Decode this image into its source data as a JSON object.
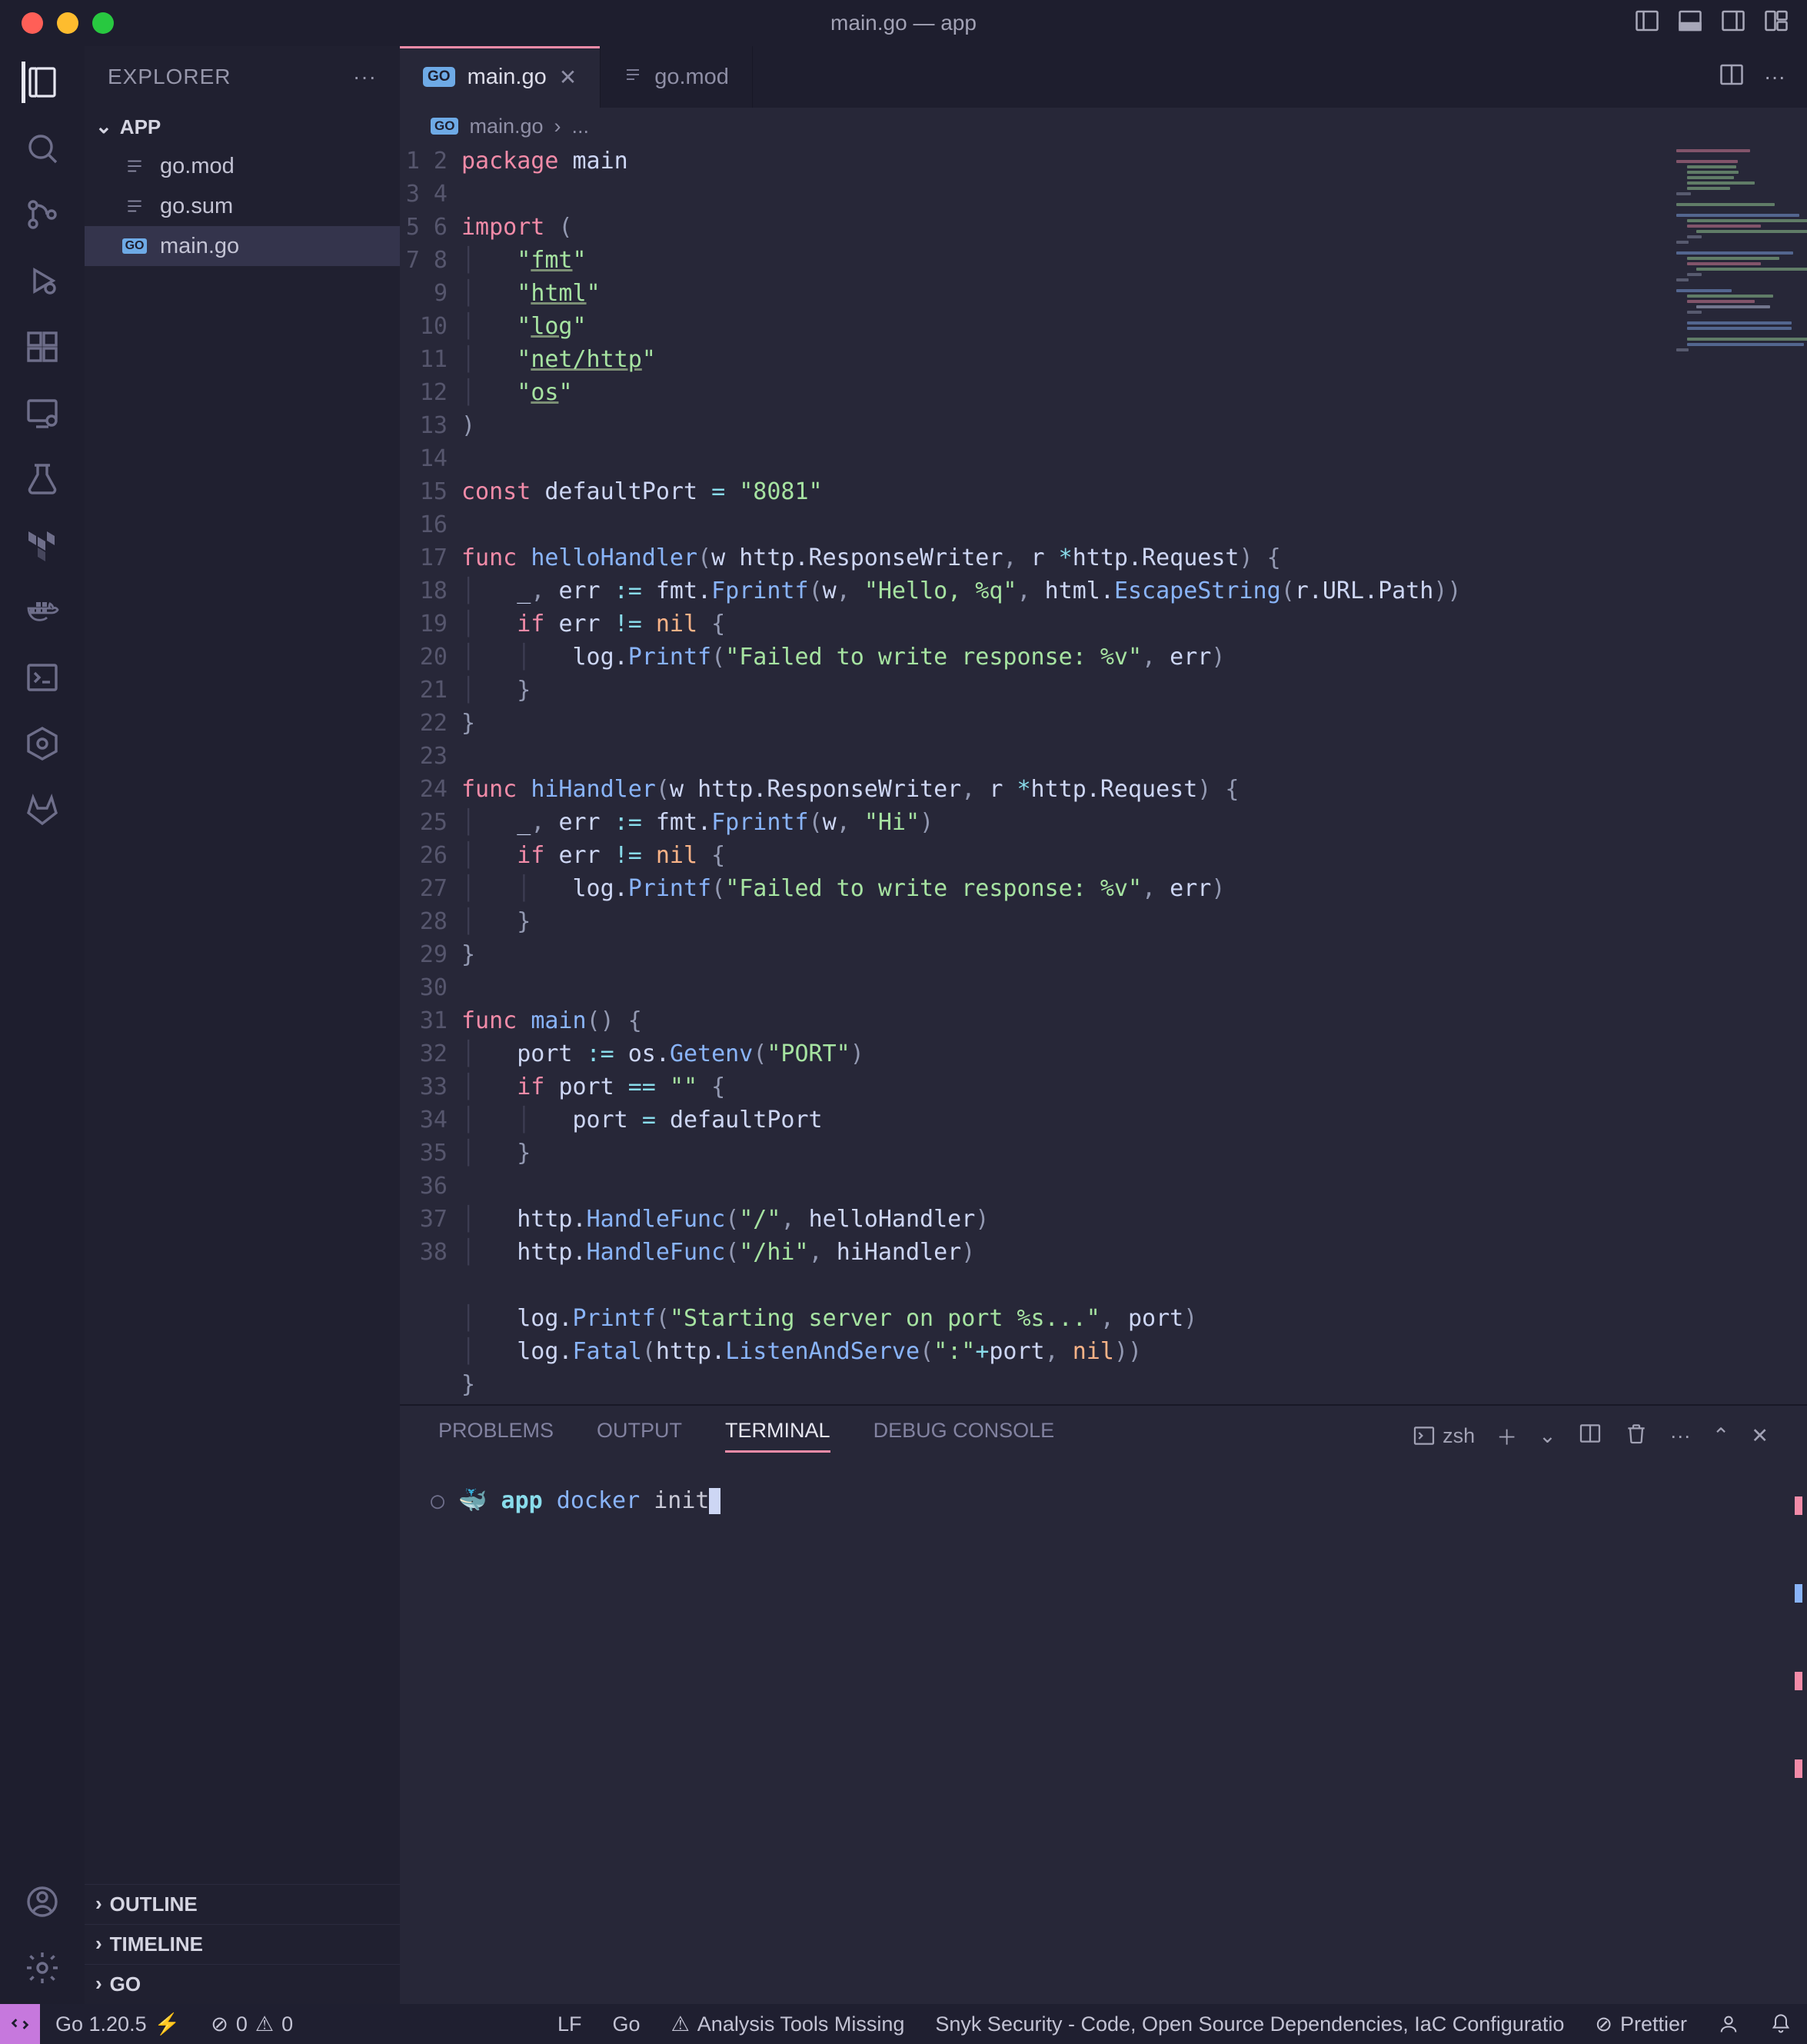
{
  "window": {
    "title": "main.go — app"
  },
  "explorer": {
    "title": "EXPLORER",
    "root": "APP",
    "files": [
      {
        "name": "go.mod",
        "icon": "lines"
      },
      {
        "name": "go.sum",
        "icon": "lines"
      },
      {
        "name": "main.go",
        "icon": "go",
        "selected": true
      }
    ],
    "collapsed": [
      "OUTLINE",
      "TIMELINE",
      "GO"
    ]
  },
  "tabs": [
    {
      "label": "main.go",
      "icon": "go",
      "active": true,
      "closable": true
    },
    {
      "label": "go.mod",
      "icon": "lines",
      "active": false,
      "closable": false
    }
  ],
  "breadcrumb": {
    "file": "main.go",
    "more": "..."
  },
  "code": {
    "lines": [
      [
        [
          "kw",
          "package"
        ],
        [
          "sp",
          " "
        ],
        [
          "pkg",
          "main"
        ]
      ],
      [],
      [
        [
          "kw",
          "import"
        ],
        [
          "sp",
          " "
        ],
        [
          "paren",
          "("
        ]
      ],
      [
        [
          "sp",
          "    "
        ],
        [
          "str",
          "\""
        ],
        [
          "strund",
          "fmt"
        ],
        [
          "str",
          "\""
        ]
      ],
      [
        [
          "sp",
          "    "
        ],
        [
          "str",
          "\""
        ],
        [
          "strund",
          "html"
        ],
        [
          "str",
          "\""
        ]
      ],
      [
        [
          "sp",
          "    "
        ],
        [
          "str",
          "\""
        ],
        [
          "strund",
          "log"
        ],
        [
          "str",
          "\""
        ]
      ],
      [
        [
          "sp",
          "    "
        ],
        [
          "str",
          "\""
        ],
        [
          "strund",
          "net/http"
        ],
        [
          "str",
          "\""
        ]
      ],
      [
        [
          "sp",
          "    "
        ],
        [
          "str",
          "\""
        ],
        [
          "strund",
          "os"
        ],
        [
          "str",
          "\""
        ]
      ],
      [
        [
          "paren",
          ")"
        ]
      ],
      [],
      [
        [
          "kw",
          "const"
        ],
        [
          "sp",
          " "
        ],
        [
          "id",
          "defaultPort"
        ],
        [
          "sp",
          " "
        ],
        [
          "op",
          "="
        ],
        [
          "sp",
          " "
        ],
        [
          "str",
          "\"8081\""
        ]
      ],
      [],
      [
        [
          "kw",
          "func"
        ],
        [
          "sp",
          " "
        ],
        [
          "fn",
          "helloHandler"
        ],
        [
          "paren",
          "("
        ],
        [
          "id",
          "w"
        ],
        [
          "sp",
          " "
        ],
        [
          "type",
          "http.ResponseWriter"
        ],
        [
          "paren",
          ","
        ],
        [
          "sp",
          " "
        ],
        [
          "id",
          "r"
        ],
        [
          "sp",
          " "
        ],
        [
          "op",
          "*"
        ],
        [
          "type",
          "http.Request"
        ],
        [
          "paren",
          ")"
        ],
        [
          "sp",
          " "
        ],
        [
          "brace",
          "{"
        ]
      ],
      [
        [
          "sp",
          "    "
        ],
        [
          "id",
          "_"
        ],
        [
          "paren",
          ","
        ],
        [
          "sp",
          " "
        ],
        [
          "id",
          "err"
        ],
        [
          "sp",
          " "
        ],
        [
          "op",
          ":="
        ],
        [
          "sp",
          " "
        ],
        [
          "id",
          "fmt."
        ],
        [
          "fn",
          "Fprintf"
        ],
        [
          "paren",
          "("
        ],
        [
          "id",
          "w"
        ],
        [
          "paren",
          ","
        ],
        [
          "sp",
          " "
        ],
        [
          "str",
          "\"Hello, %q\""
        ],
        [
          "paren",
          ","
        ],
        [
          "sp",
          " "
        ],
        [
          "id",
          "html."
        ],
        [
          "fn",
          "EscapeString"
        ],
        [
          "paren",
          "("
        ],
        [
          "id",
          "r.URL.Path"
        ],
        [
          "paren",
          "))"
        ]
      ],
      [
        [
          "sp",
          "    "
        ],
        [
          "kw",
          "if"
        ],
        [
          "sp",
          " "
        ],
        [
          "id",
          "err"
        ],
        [
          "sp",
          " "
        ],
        [
          "op",
          "!="
        ],
        [
          "sp",
          " "
        ],
        [
          "nil",
          "nil"
        ],
        [
          "sp",
          " "
        ],
        [
          "brace",
          "{"
        ]
      ],
      [
        [
          "sp",
          "        "
        ],
        [
          "id",
          "log."
        ],
        [
          "fn",
          "Printf"
        ],
        [
          "paren",
          "("
        ],
        [
          "str",
          "\"Failed to write response: %v\""
        ],
        [
          "paren",
          ","
        ],
        [
          "sp",
          " "
        ],
        [
          "id",
          "err"
        ],
        [
          "paren",
          ")"
        ]
      ],
      [
        [
          "sp",
          "    "
        ],
        [
          "brace",
          "}"
        ]
      ],
      [
        [
          "brace",
          "}"
        ]
      ],
      [],
      [
        [
          "kw",
          "func"
        ],
        [
          "sp",
          " "
        ],
        [
          "fn",
          "hiHandler"
        ],
        [
          "paren",
          "("
        ],
        [
          "id",
          "w"
        ],
        [
          "sp",
          " "
        ],
        [
          "type",
          "http.ResponseWriter"
        ],
        [
          "paren",
          ","
        ],
        [
          "sp",
          " "
        ],
        [
          "id",
          "r"
        ],
        [
          "sp",
          " "
        ],
        [
          "op",
          "*"
        ],
        [
          "type",
          "http.Request"
        ],
        [
          "paren",
          ")"
        ],
        [
          "sp",
          " "
        ],
        [
          "brace",
          "{"
        ]
      ],
      [
        [
          "sp",
          "    "
        ],
        [
          "id",
          "_"
        ],
        [
          "paren",
          ","
        ],
        [
          "sp",
          " "
        ],
        [
          "id",
          "err"
        ],
        [
          "sp",
          " "
        ],
        [
          "op",
          ":="
        ],
        [
          "sp",
          " "
        ],
        [
          "id",
          "fmt."
        ],
        [
          "fn",
          "Fprintf"
        ],
        [
          "paren",
          "("
        ],
        [
          "id",
          "w"
        ],
        [
          "paren",
          ","
        ],
        [
          "sp",
          " "
        ],
        [
          "str",
          "\"Hi\""
        ],
        [
          "paren",
          ")"
        ]
      ],
      [
        [
          "sp",
          "    "
        ],
        [
          "kw",
          "if"
        ],
        [
          "sp",
          " "
        ],
        [
          "id",
          "err"
        ],
        [
          "sp",
          " "
        ],
        [
          "op",
          "!="
        ],
        [
          "sp",
          " "
        ],
        [
          "nil",
          "nil"
        ],
        [
          "sp",
          " "
        ],
        [
          "brace",
          "{"
        ]
      ],
      [
        [
          "sp",
          "        "
        ],
        [
          "id",
          "log."
        ],
        [
          "fn",
          "Printf"
        ],
        [
          "paren",
          "("
        ],
        [
          "str",
          "\"Failed to write response: %v\""
        ],
        [
          "paren",
          ","
        ],
        [
          "sp",
          " "
        ],
        [
          "id",
          "err"
        ],
        [
          "paren",
          ")"
        ]
      ],
      [
        [
          "sp",
          "    "
        ],
        [
          "brace",
          "}"
        ]
      ],
      [
        [
          "brace",
          "}"
        ]
      ],
      [],
      [
        [
          "kw",
          "func"
        ],
        [
          "sp",
          " "
        ],
        [
          "fn",
          "main"
        ],
        [
          "paren",
          "()"
        ],
        [
          "sp",
          " "
        ],
        [
          "brace",
          "{"
        ]
      ],
      [
        [
          "sp",
          "    "
        ],
        [
          "id",
          "port"
        ],
        [
          "sp",
          " "
        ],
        [
          "op",
          ":="
        ],
        [
          "sp",
          " "
        ],
        [
          "id",
          "os."
        ],
        [
          "fn",
          "Getenv"
        ],
        [
          "paren",
          "("
        ],
        [
          "str",
          "\"PORT\""
        ],
        [
          "paren",
          ")"
        ]
      ],
      [
        [
          "sp",
          "    "
        ],
        [
          "kw",
          "if"
        ],
        [
          "sp",
          " "
        ],
        [
          "id",
          "port"
        ],
        [
          "sp",
          " "
        ],
        [
          "op",
          "=="
        ],
        [
          "sp",
          " "
        ],
        [
          "str",
          "\"\""
        ],
        [
          "sp",
          " "
        ],
        [
          "brace",
          "{"
        ]
      ],
      [
        [
          "sp",
          "        "
        ],
        [
          "id",
          "port"
        ],
        [
          "sp",
          " "
        ],
        [
          "op",
          "="
        ],
        [
          "sp",
          " "
        ],
        [
          "id",
          "defaultPort"
        ]
      ],
      [
        [
          "sp",
          "    "
        ],
        [
          "brace",
          "}"
        ]
      ],
      [],
      [
        [
          "sp",
          "    "
        ],
        [
          "id",
          "http."
        ],
        [
          "fn",
          "HandleFunc"
        ],
        [
          "paren",
          "("
        ],
        [
          "str",
          "\"/\""
        ],
        [
          "paren",
          ","
        ],
        [
          "sp",
          " "
        ],
        [
          "id",
          "helloHandler"
        ],
        [
          "paren",
          ")"
        ]
      ],
      [
        [
          "sp",
          "    "
        ],
        [
          "id",
          "http."
        ],
        [
          "fn",
          "HandleFunc"
        ],
        [
          "paren",
          "("
        ],
        [
          "str",
          "\"/hi\""
        ],
        [
          "paren",
          ","
        ],
        [
          "sp",
          " "
        ],
        [
          "id",
          "hiHandler"
        ],
        [
          "paren",
          ")"
        ]
      ],
      [],
      [
        [
          "sp",
          "    "
        ],
        [
          "id",
          "log."
        ],
        [
          "fn",
          "Printf"
        ],
        [
          "paren",
          "("
        ],
        [
          "str",
          "\"Starting server on port %s...\""
        ],
        [
          "paren",
          ","
        ],
        [
          "sp",
          " "
        ],
        [
          "id",
          "port"
        ],
        [
          "paren",
          ")"
        ]
      ],
      [
        [
          "sp",
          "    "
        ],
        [
          "id",
          "log."
        ],
        [
          "fn",
          "Fatal"
        ],
        [
          "paren",
          "("
        ],
        [
          "id",
          "http."
        ],
        [
          "fn",
          "ListenAndServe"
        ],
        [
          "paren",
          "("
        ],
        [
          "str",
          "\":\""
        ],
        [
          "op",
          "+"
        ],
        [
          "id",
          "port"
        ],
        [
          "paren",
          ","
        ],
        [
          "sp",
          " "
        ],
        [
          "nil",
          "nil"
        ],
        [
          "paren",
          "))"
        ]
      ],
      [
        [
          "brace",
          "}"
        ]
      ]
    ]
  },
  "panel": {
    "tabs": [
      "PROBLEMS",
      "OUTPUT",
      "TERMINAL",
      "DEBUG CONSOLE"
    ],
    "active": "TERMINAL",
    "shell": "zsh",
    "prompt": {
      "cwd": "app",
      "command": "docker",
      "args": "init"
    }
  },
  "status": {
    "go": "Go 1.20.5",
    "errors": "0",
    "warnings": "0",
    "lf": "LF",
    "lang": "Go",
    "tools": "Analysis Tools Missing",
    "snyk": "Snyk Security - Code, Open Source Dependencies, IaC Configuratio",
    "prettier": "Prettier"
  }
}
